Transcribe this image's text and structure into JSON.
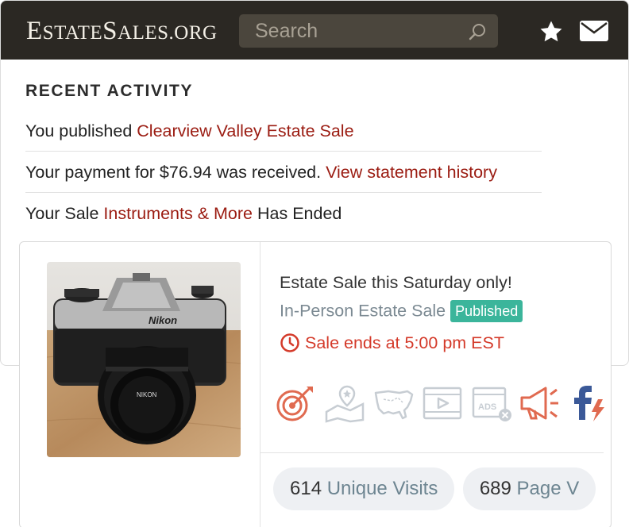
{
  "header": {
    "logo_part1": "E",
    "logo_part2": "STATE",
    "logo_part3": "S",
    "logo_part4": "ALES",
    "logo_part5": ".ORG",
    "search_placeholder": "Search",
    "icons": [
      "search-icon",
      "star-icon",
      "mail-icon"
    ]
  },
  "recent_activity": {
    "title": "RECENT ACTIVITY",
    "items": [
      {
        "text": "You published ",
        "link": "Clearview Valley Estate Sale",
        "suffix": ""
      },
      {
        "text": "Your payment for $76.94 was received. ",
        "link": "View statement history",
        "suffix": ""
      },
      {
        "text": "Your Sale ",
        "link": "Instruments & More",
        "suffix": " Has Ended"
      }
    ]
  },
  "card": {
    "title": "Estate Sale this Saturday only!",
    "sale_type": "In-Person Estate Sale",
    "status_badge": "Published",
    "ends": "Sale ends at 5:00 pm EST",
    "tools": [
      "target-icon",
      "map-pin-icon",
      "usa-map-icon",
      "video-icon",
      "ads-icon",
      "megaphone-icon",
      "facebook-boost-icon"
    ],
    "stats": [
      {
        "value": "614",
        "label": "Unique Visits"
      },
      {
        "value": "689",
        "label": "Page V"
      }
    ]
  },
  "colors": {
    "header_bg": "#2b2823",
    "link": "#9b1c12",
    "badge": "#3bb59b",
    "alert": "#d43a2a",
    "stat_label": "#6d8591"
  }
}
